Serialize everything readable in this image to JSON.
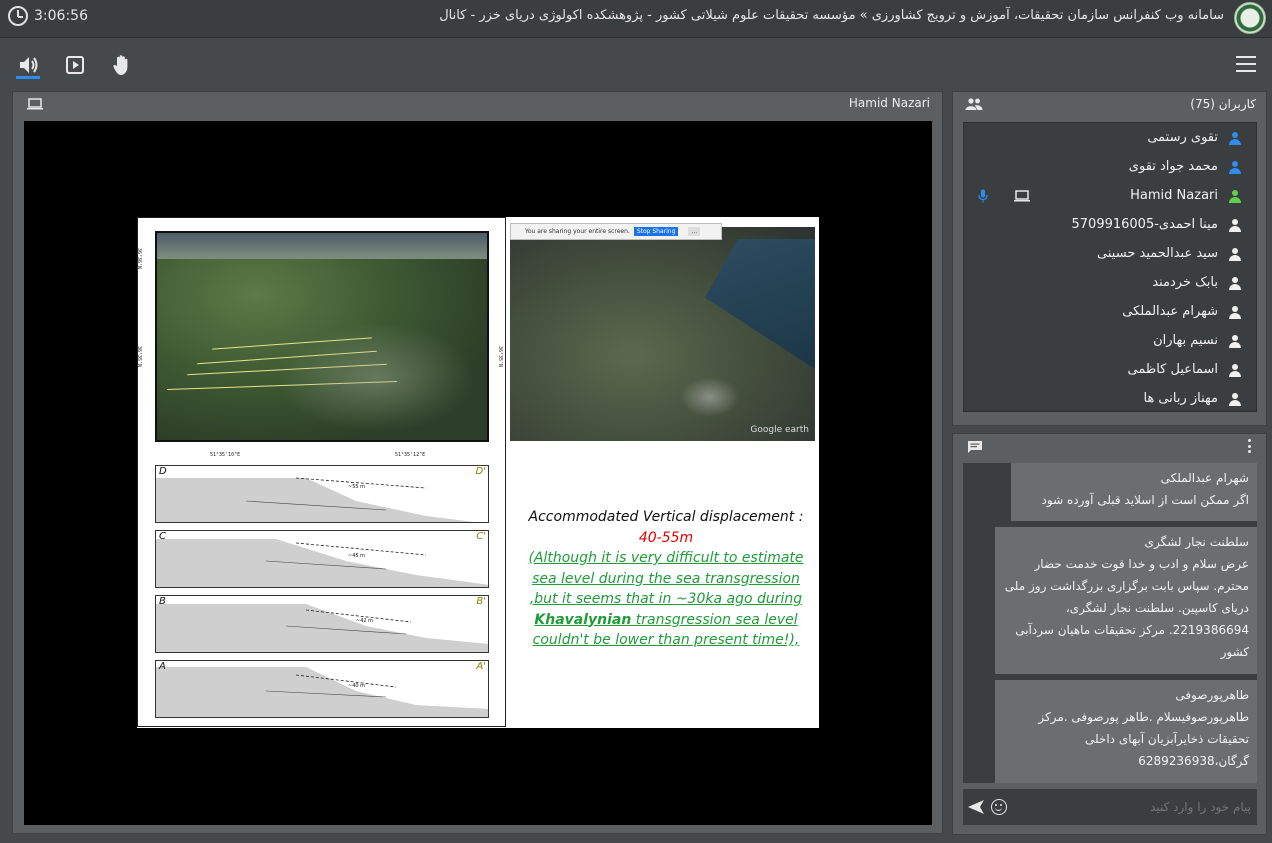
{
  "header": {
    "timer": "3:06:56",
    "title": "سامانه وب کنفرانس سازمان تحقیقات، آموزش و ترویج کشاورزی » مؤسسه تحقیقات علوم شیلاتی کشور - پژوهشکده اکولوژی دریای خزر - کانال"
  },
  "toolbar": {
    "audio_icon": "speaker-icon",
    "present_icon": "play-box-icon",
    "raise_hand_icon": "hand-icon",
    "menu_icon": "hamburger-icon"
  },
  "presentation": {
    "presenter": "Hamid Nazari",
    "share_bar": {
      "text": "You are sharing your entire screen.",
      "stop_label": "Stop Sharing",
      "close_label": "..."
    },
    "map_coords": {
      "lat_top": "36°36'N",
      "lat_mid": "36°35'N",
      "lat_right": "36°35'N",
      "lon_left": "51°35'10\"E",
      "lon_right": "51°35'12\"E"
    },
    "profiles": [
      {
        "start": "D",
        "end": "D'",
        "depth": "~55 m"
      },
      {
        "start": "C",
        "end": "C'",
        "depth": "~45 m"
      },
      {
        "start": "B",
        "end": "B'",
        "depth": "~42 m"
      },
      {
        "start": "A",
        "end": "A'",
        "depth": "~40 m"
      }
    ],
    "google_earth_label": "Google earth",
    "caption_title": "Accommodated Vertical displacement :",
    "caption_range": "40-55m",
    "caption_note_1": "(Although it is very difficult to estimate sea level during the sea transgression ,but it seems that in ~30ka ago during",
    "caption_note_bold": "Khavalynian",
    "caption_note_2": "transgression sea level couldn't be lower than present time!),"
  },
  "users": {
    "title": "کاربران (75)",
    "list": [
      {
        "name": "تقوی رستمی",
        "color": "#2f8cf0",
        "mic": false,
        "screen": false
      },
      {
        "name": "محمد جواد تقوی",
        "color": "#2f8cf0",
        "mic": false,
        "screen": false
      },
      {
        "name": "Hamid Nazari",
        "color": "#5fd14a",
        "mic": true,
        "screen": true
      },
      {
        "name": "مینا احمدی-5709916005",
        "color": "#f0f0f0",
        "mic": false,
        "screen": false
      },
      {
        "name": "سید عبدالحمید حسینی",
        "color": "#f0f0f0",
        "mic": false,
        "screen": false
      },
      {
        "name": "بابک خردمند",
        "color": "#f0f0f0",
        "mic": false,
        "screen": false
      },
      {
        "name": "شهرام عبدالملکی",
        "color": "#f0f0f0",
        "mic": false,
        "screen": false
      },
      {
        "name": "نسیم بهاران",
        "color": "#f0f0f0",
        "mic": false,
        "screen": false
      },
      {
        "name": "اسماعیل کاظمی",
        "color": "#f0f0f0",
        "mic": false,
        "screen": false
      },
      {
        "name": "مهناز ربانی ها",
        "color": "#f0f0f0",
        "mic": false,
        "screen": false
      }
    ]
  },
  "chat": {
    "messages": [
      {
        "author": "شهرام عبدالملکی",
        "body": "اگر ممکن است از اسلاید قبلی آورده شود"
      },
      {
        "author": "سلطنت نجار لشگری",
        "body": "عرض سلام و ادب و خدا قوت خدمت حضار محترم. سپاس بابت برگزاری بزرگداشت روز ملی دریای کاسپین. سلطنت نجار لشگری، 2219386694. مرکز تحقیقات ماهیان سردآبی کشور"
      },
      {
        "author": "طاهرپورصوفی",
        "body": "طاهرپورصوفیسلام .طاهر پورصوفی .مرکز تحقیقات ذخایرآبزیان آبهای داخلی گرگان،6289236938"
      }
    ],
    "input_placeholder": "پیام خود را وارد کنید"
  }
}
